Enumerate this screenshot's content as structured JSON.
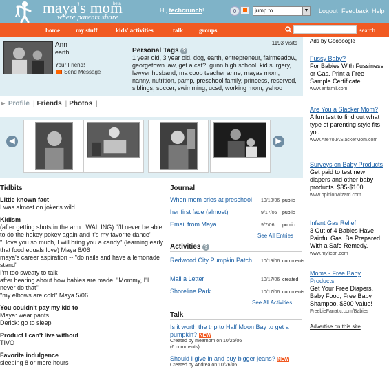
{
  "header": {
    "logo_text": "maya's mom",
    "logo_beta": "beta",
    "tagline": "where parents share",
    "greeting_prefix": "Hi, ",
    "username": "techcrunch",
    "greeting_suffix": "!",
    "notifications": "0",
    "jump_select": "jump to...",
    "links": {
      "logout": "Logout",
      "feedback": "Feedback",
      "help": "Help"
    }
  },
  "nav": {
    "items": [
      "home",
      "my stuff",
      "kids' activities",
      "talk",
      "groups"
    ],
    "search_button": "search",
    "search_value": ""
  },
  "profile": {
    "name": "Ann",
    "location": "earth",
    "friend_label": "Your Friend!",
    "send_message": "Send Message",
    "visits": "1193 visits",
    "tags_title": "Personal Tags",
    "tags": "1 year old, 3 year old, dog, earth, entrepreneur, fairmeadow, georgetown law, get a cat?, gunn high school, kid surgery, lawyer husband, ma coop teacher anne, mayas mom, nanny, nutrition, pamp, preschool family, princess, reserved, siblings, soccer, swimming, ucsd, working mom, yahoo"
  },
  "tabs": [
    "Profile",
    "Friends",
    "Photos"
  ],
  "tidbits": {
    "title": "Tidbits",
    "items": [
      {
        "heading": "Little known fact",
        "lines": [
          "I was almost on joker's wild"
        ]
      },
      {
        "heading": "Kidism",
        "lines": [
          "(after getting shots in the arm...WAILING) \"i'll never be able to do the hokey pokey again and it's my favorite dance\"",
          "\"I love you so much, I will bring you a candy\" (learning early that food equals love) Maya 8/06",
          "maya's career aspiration -- \"do nails and have a lemonade stand\"",
          "I'm too sweaty to talk",
          "after hearing about how babies are made, \"Mommy, I'll never do that\"",
          "\"my elbows are cold\" Maya 5/06"
        ]
      },
      {
        "heading": "You couldn't pay my kid to",
        "lines": [
          "Maya: wear pants",
          "Derick: go to sleep"
        ]
      },
      {
        "heading": "Product I can't live without",
        "lines": [
          "TIVO"
        ]
      },
      {
        "heading": "Favorite indulgence",
        "lines": [
          "sleeping 8 or more hours"
        ]
      }
    ]
  },
  "journal": {
    "title": "Journal",
    "entries": [
      {
        "title": "When mom cries at preschool",
        "date": "10/10/06",
        "visibility": "public"
      },
      {
        "title": "her first face (almost)",
        "date": "9/17/06",
        "visibility": "public"
      },
      {
        "title": "Email from Maya...",
        "date": "9/7/06",
        "visibility": "public"
      }
    ],
    "see_all": "See All Entries"
  },
  "activities": {
    "title": "Activities",
    "entries": [
      {
        "title": "Redwood City Pumpkin Patch",
        "date": "10/19/06",
        "status": "comments"
      },
      {
        "title": "Mail a Letter",
        "date": "10/17/06",
        "status": "created"
      },
      {
        "title": "Shoreline Park",
        "date": "10/17/06",
        "status": "comments"
      }
    ],
    "see_all": "See All Activities"
  },
  "talk": {
    "title": "Talk",
    "posts": [
      {
        "title": "Is it worth the trip to Half Moon Bay to get a pumpkin?",
        "badge": "NEW",
        "meta": "Created by meamom on 10/26/06",
        "comments": "(6 comments)"
      },
      {
        "title": "Should I give in and buy bigger jeans?",
        "badge": "NEW",
        "meta": "Created by Andrea on 10/26/06"
      }
    ]
  },
  "ads": {
    "header": "Ads by Gooooogle",
    "items": [
      {
        "title": "Fussy Baby?",
        "body": "For Babies With Fussiness or Gas. Print a Free Sample Certificate.",
        "url": "www.enfamil.com"
      },
      {
        "title": "Are You a Slacker Mom?",
        "body": "A fun test to find out what type of parenting style fits you.",
        "url": "www.AreYouASlackerMom.com"
      },
      {
        "title": "Surveys on Baby Products",
        "body": "Get paid to test new diapers and other baby products. $35-$100",
        "url": "www.opinionwizard.com"
      },
      {
        "title": "Infant Gas Relief",
        "body": "3 Out of 4 Babies Have Painful Gas. Be Prepared With a Safe Remedy.",
        "url": "www.mylicon.com"
      },
      {
        "title": "Moms - Free Baby Products",
        "body": "Get Your Free Diapers, Baby Food, Free Baby Shampoo. $500 Value!",
        "url": "FreebieFanatic.com/Babies"
      }
    ],
    "footer": "Advertise on this site"
  },
  "colors": {
    "top_bar": "#7fb3c8",
    "nav_bar": "#f15a22",
    "panel": "#dfeef3",
    "link": "#1a5fa5"
  }
}
